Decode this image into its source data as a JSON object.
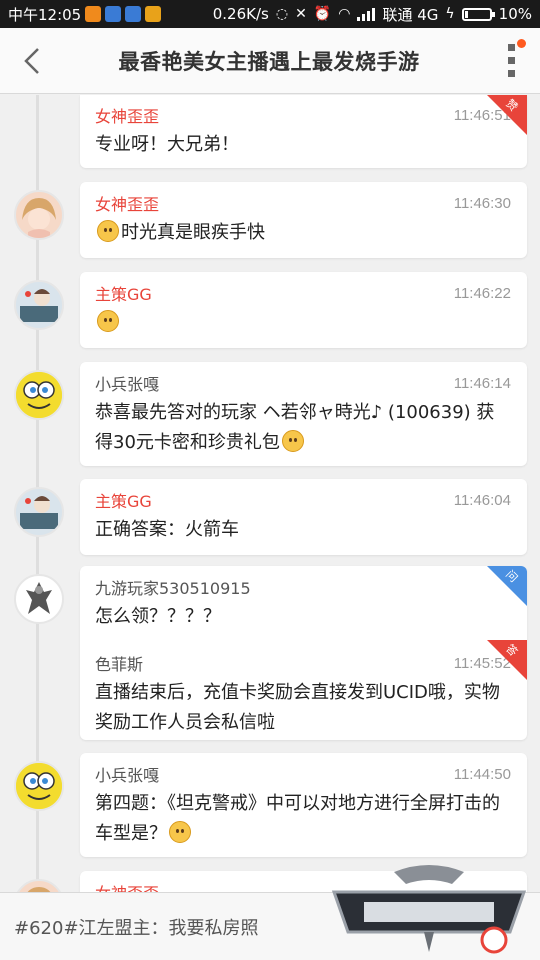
{
  "status_bar": {
    "time": "中午12:05",
    "speed": "0.26K/s",
    "carrier": "联通 4G",
    "battery": "10%",
    "app_icon_colors": [
      "#f08a1c",
      "#3a7bd5",
      "#3a7bd5",
      "#e8a21a"
    ]
  },
  "header": {
    "title": "最香艳美女主播遇上最发烧手游"
  },
  "messages": [
    {
      "name": "女神歪歪",
      "time": "11:46:51",
      "text": "专业呀！大兄弟！",
      "badge": "赞"
    },
    {
      "name": "女神歪歪",
      "time": "11:46:30",
      "text": "时光真是眼疾手快"
    },
    {
      "name": "主策GG",
      "time": "11:46:22",
      "text": ""
    },
    {
      "name": "小兵张嘎",
      "time": "11:46:14",
      "text": "恭喜最先答对的玩家 ヘ若邻ャ時光♪ (100639) 获得30元卡密和珍贵礼包"
    },
    {
      "name": "主策GG",
      "time": "11:46:04",
      "text": "正确答案：火箭车"
    },
    {
      "name": "九游玩家530510915",
      "text": "怎么领？？？？",
      "badge": "问"
    },
    {
      "name": "色菲斯",
      "time": "11:45:52",
      "text": "直播结束后，充值卡奖励会直接发到UCID哦，实物奖励工作人员会私信啦",
      "badge": "答"
    },
    {
      "name": "小兵张嘎",
      "time": "11:44:50",
      "text": "第四题：《坦克警戒》中可以对地方进行全屏打击的车型是？"
    },
    {
      "name": "女神歪歪"
    }
  ],
  "bottom_bar": {
    "text": "#620#江左盟主：我要私房照"
  },
  "colors": {
    "host_name": "#e8443a",
    "badge_red": "#e8443a",
    "badge_blue": "#4a90e2"
  }
}
